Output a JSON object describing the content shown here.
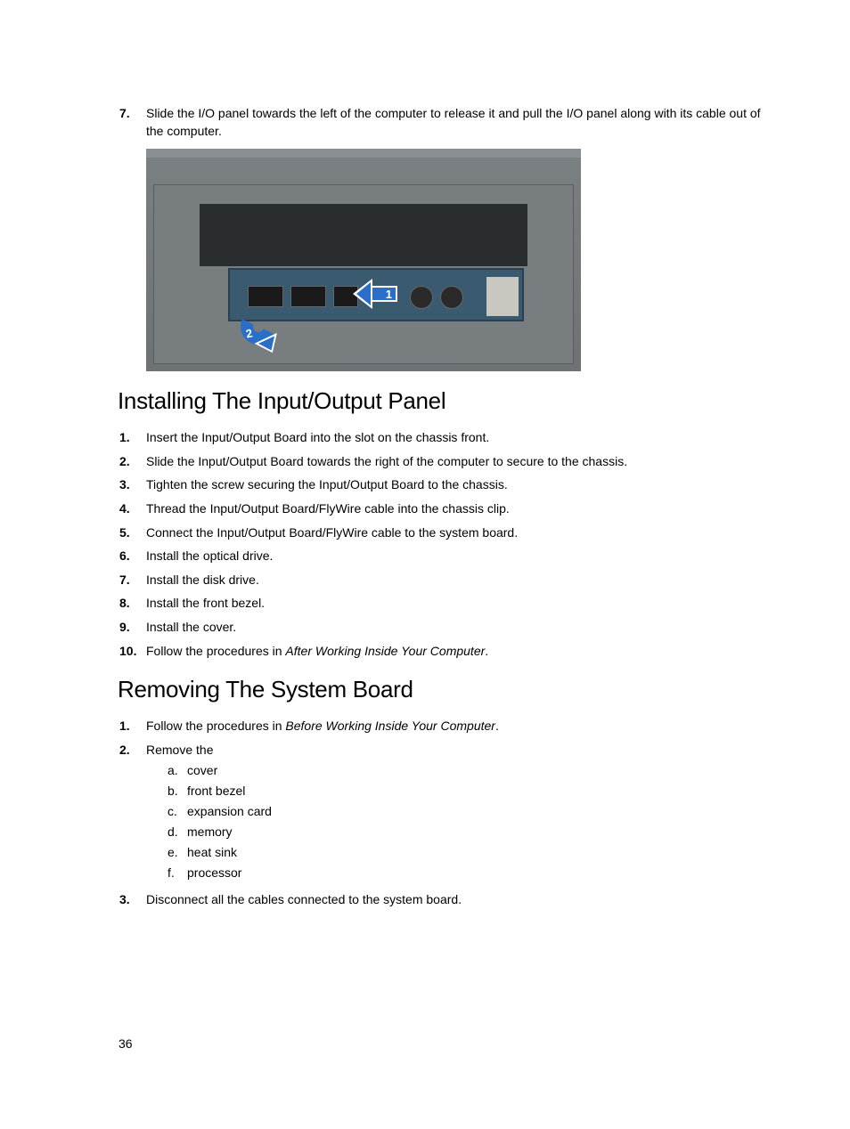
{
  "topStep": {
    "num": "7.",
    "text": "Slide the I/O panel towards the left of the computer to release it and pull the I/O panel along with its cable out of the computer."
  },
  "figure": {
    "label1": "1",
    "label2": "2"
  },
  "section1": {
    "heading": "Installing The Input/Output Panel",
    "steps": [
      {
        "num": "1.",
        "text": "Insert the Input/Output Board into the slot on the chassis front."
      },
      {
        "num": "2.",
        "text": "Slide the Input/Output Board towards the right of the computer to secure to the chassis."
      },
      {
        "num": "3.",
        "text": "Tighten the screw securing the Input/Output Board to the chassis."
      },
      {
        "num": "4.",
        "text": "Thread the Input/Output Board/FlyWire cable into the chassis clip."
      },
      {
        "num": "5.",
        "text": "Connect the Input/Output Board/FlyWire cable to the system board."
      },
      {
        "num": "6.",
        "text": "Install the optical drive."
      },
      {
        "num": "7.",
        "text": "Install the disk drive."
      },
      {
        "num": "8.",
        "text": "Install the front bezel."
      },
      {
        "num": "9.",
        "text": "Install the cover."
      },
      {
        "num": "10.",
        "prefix": "Follow the procedures in ",
        "italic": "After Working Inside Your Computer",
        "suffix": "."
      }
    ]
  },
  "section2": {
    "heading": "Removing The System Board",
    "steps": [
      {
        "num": "1.",
        "prefix": "Follow the procedures in ",
        "italic": "Before Working Inside Your Computer",
        "suffix": "."
      },
      {
        "num": "2.",
        "text": "Remove the",
        "sub": [
          {
            "letter": "a.",
            "text": "cover"
          },
          {
            "letter": "b.",
            "text": "front bezel"
          },
          {
            "letter": "c.",
            "text": "expansion card"
          },
          {
            "letter": "d.",
            "text": "memory"
          },
          {
            "letter": "e.",
            "text": "heat sink"
          },
          {
            "letter": "f.",
            "text": "processor"
          }
        ]
      },
      {
        "num": "3.",
        "text": "Disconnect all the cables connected to the system board."
      }
    ]
  },
  "pageNum": "36"
}
